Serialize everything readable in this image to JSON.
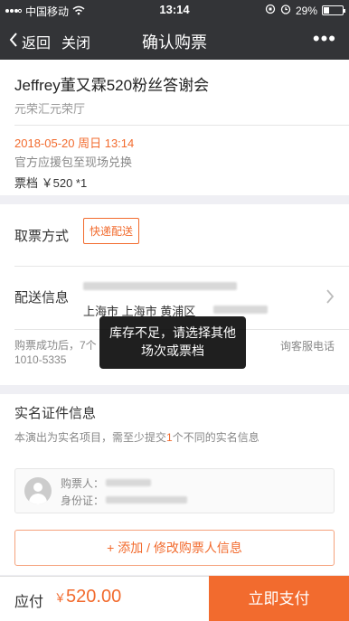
{
  "status_bar": {
    "carrier": "中国移动",
    "time": "13:14",
    "battery": "29%",
    "battery_level": 0.29
  },
  "nav": {
    "back_label": "返回",
    "close_label": "关闭",
    "title": "确认购票",
    "more_label": "•••"
  },
  "event": {
    "title": "Jeffrey董又霖520粉丝答谢会",
    "venue": "元荣汇元荣厅",
    "session": "2018-05-20 周日 13:14",
    "pickup_note": "官方应援包至现场兑换",
    "price_line": "票档 ￥520 *1"
  },
  "delivery": {
    "method_label": "取票方式",
    "method_value": "快递配送",
    "info_label": "配送信息",
    "address": "上海市 上海市 黄浦区",
    "note_start": "购票成功后，7个",
    "note_tail": "询客服电话",
    "phone": "1010-5335"
  },
  "realname": {
    "title": "实名证件信息",
    "desc_prefix": "本演出为实名项目，需至少提交",
    "desc_count": "1",
    "desc_suffix": "个不同的实名信息",
    "buyer_label": "购票人：",
    "id_label": "身份证：",
    "add_button": "+ 添加 / 修改购票人信息"
  },
  "footer": {
    "total_label": "应付",
    "currency": "￥",
    "amount": "520.00",
    "pay_button": "立即支付"
  },
  "toast": {
    "message": "库存不足，请选择其他场次或票档"
  },
  "colors": {
    "accent": "#f26b2e",
    "nav_bg": "#333437"
  }
}
